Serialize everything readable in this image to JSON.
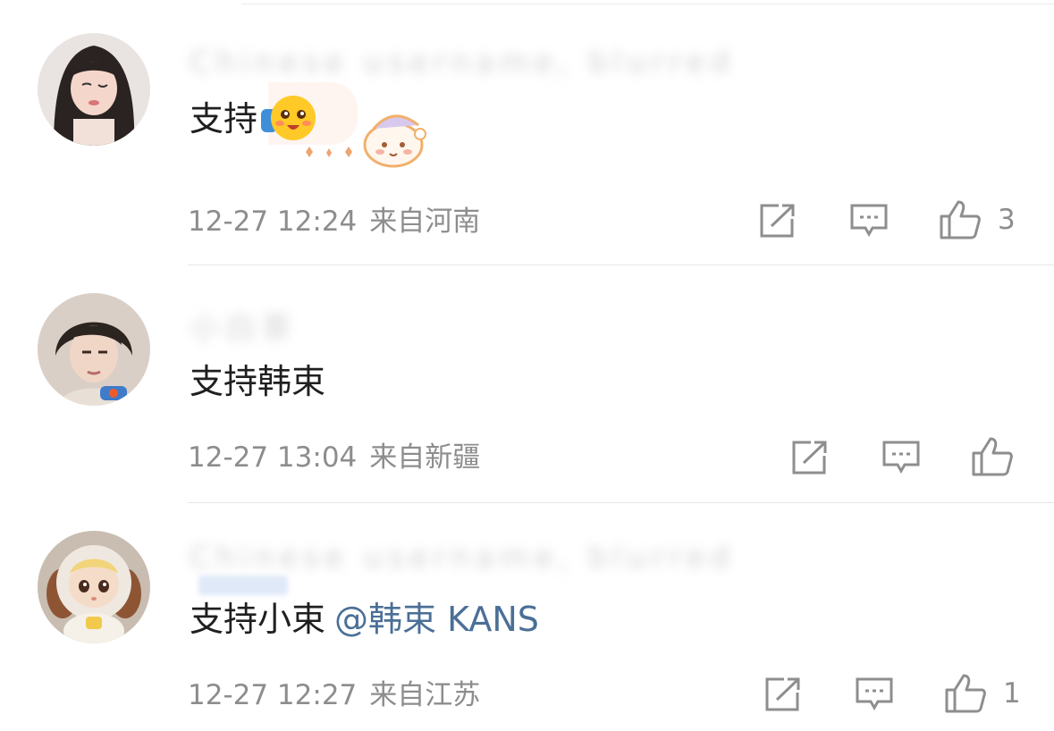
{
  "comments": [
    {
      "username": "Chinese username, blurred",
      "content": "支持",
      "emoji": "blushing-emoji",
      "timestamp": "12-27 12:24",
      "location": "来自河南",
      "likes": "3"
    },
    {
      "username": "小白茶",
      "content": "支持韩束",
      "timestamp": "12-27 13:04",
      "location": "来自新疆",
      "likes": ""
    },
    {
      "username": "Chinese username, blurred",
      "content": "支持小束",
      "mention": "@韩束 KANS",
      "timestamp": "12-27 12:27",
      "location": "来自江苏",
      "likes": "1"
    }
  ],
  "icons": {
    "share": "share-icon",
    "reply": "reply-icon",
    "like": "thumbs-up-icon"
  },
  "colors": {
    "text": "#1f1f1f",
    "meta": "#8d8d8d",
    "mention": "#4b6f97",
    "divider": "#e6e6e6"
  }
}
